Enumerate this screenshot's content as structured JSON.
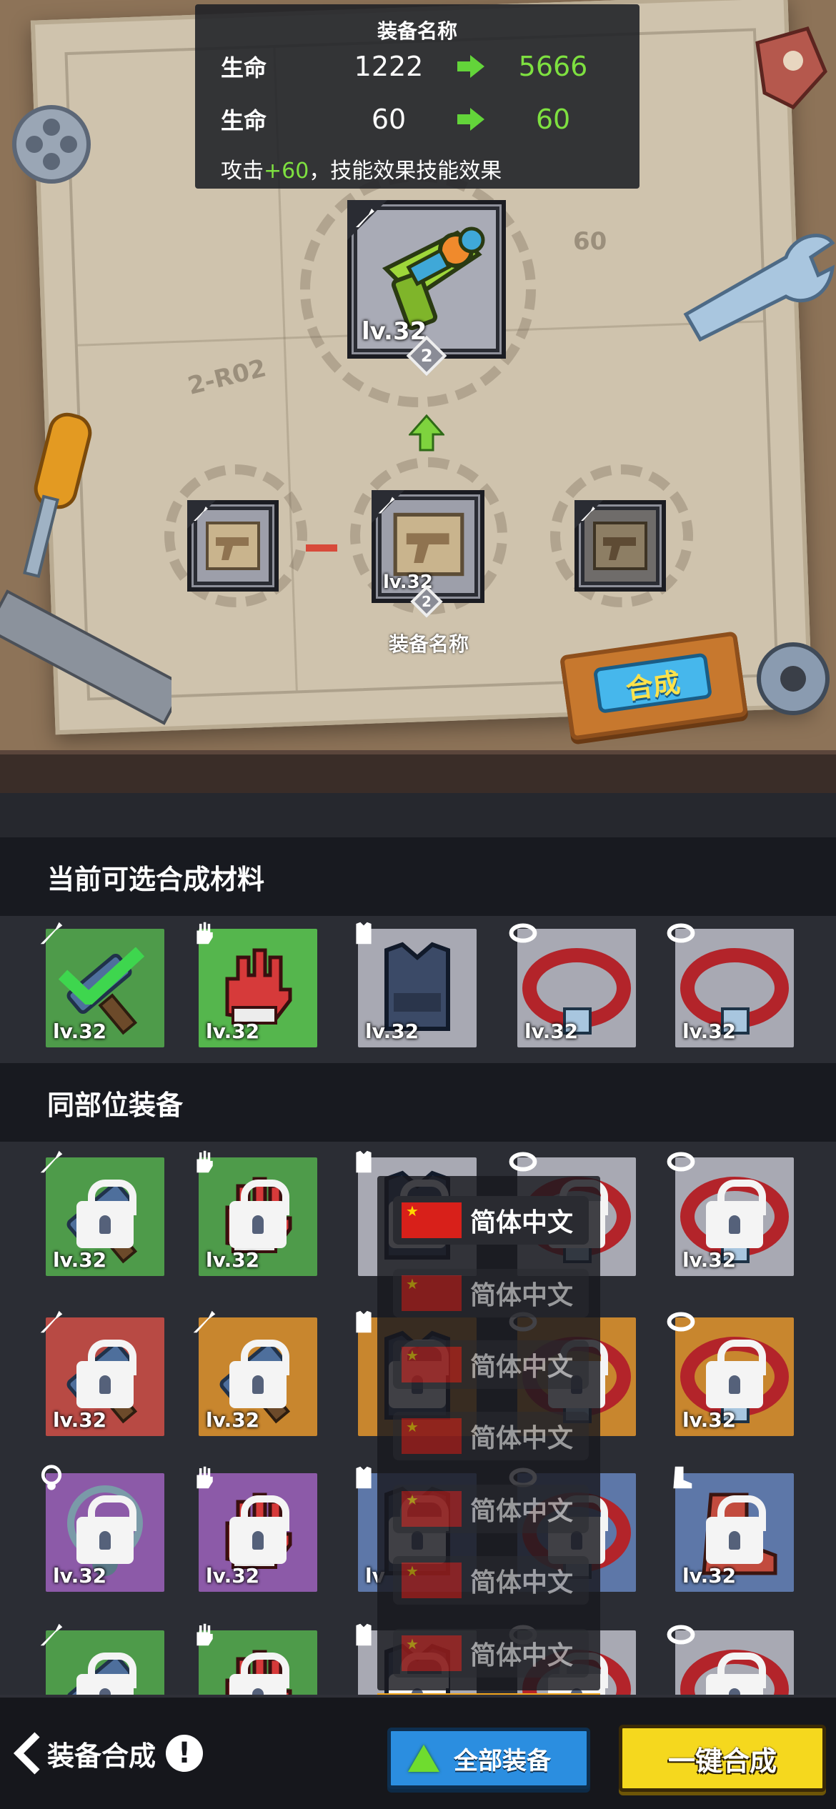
{
  "info_panel": {
    "title": "装备名称",
    "stats": [
      {
        "label": "生命",
        "old": "1222",
        "new": "5666"
      },
      {
        "label": "生命",
        "old": "60",
        "new": "60"
      }
    ],
    "desc_prefix": "攻击",
    "desc_bonus": "+60",
    "desc_suffix": "，技能效果技能效果"
  },
  "result_item": {
    "level": "lv.32",
    "stars": "2"
  },
  "materials_slots": [
    {
      "level": ""
    },
    {
      "level": "lv.32",
      "stars": "2",
      "name": "装备名称"
    },
    {
      "level": ""
    }
  ],
  "combine_button": "合成",
  "board_marks": [
    "2-R02",
    "60"
  ],
  "section_materials": {
    "title": "当前可选合成材料",
    "items": [
      {
        "level": "lv.32",
        "color": "#4e9b4a",
        "icon": "weapon-icon",
        "selected": true
      },
      {
        "level": "lv.32",
        "color": "#55b64d",
        "icon": "glove-icon"
      },
      {
        "level": "lv.32",
        "color": "#a8a9b3",
        "icon": "vest-icon"
      },
      {
        "level": "lv.32",
        "color": "#a8a9b3",
        "icon": "belt-icon"
      },
      {
        "level": "lv.32",
        "color": "#a8a9b3",
        "icon": "belt-icon"
      }
    ]
  },
  "section_same_slot": {
    "title": "同部位装备",
    "rows": [
      [
        {
          "level": "lv.32",
          "color": "#4e9b4a",
          "icon": "weapon-icon"
        },
        {
          "level": "lv.32",
          "color": "#4e9b4a",
          "icon": "glove-icon"
        },
        {
          "level": "",
          "color": "#a8a9b3",
          "icon": "vest-icon"
        },
        {
          "level": "",
          "color": "#a8a9b3",
          "icon": "belt-icon"
        },
        {
          "level": "lv.32",
          "color": "#a8a9b3",
          "icon": "belt-icon"
        }
      ],
      [
        {
          "level": "lv.32",
          "color": "#b84a44",
          "icon": "weapon-icon"
        },
        {
          "level": "lv.32",
          "color": "#c8862e",
          "icon": "weapon-icon"
        },
        {
          "level": "",
          "color": "#c8862e",
          "icon": "vest-icon"
        },
        {
          "level": "",
          "color": "#c8862e",
          "icon": "belt-icon"
        },
        {
          "level": "lv.32",
          "color": "#c8862e",
          "icon": "belt-icon"
        }
      ],
      [
        {
          "level": "lv.32",
          "color": "#8c5aa8",
          "icon": "necklace-icon"
        },
        {
          "level": "lv.32",
          "color": "#8c5aa8",
          "icon": "glove-icon"
        },
        {
          "level": "lv",
          "color": "#5d77a8",
          "icon": "vest-icon"
        },
        {
          "level": "",
          "color": "#5d77a8",
          "icon": "belt-icon"
        },
        {
          "level": "lv.32",
          "color": "#5d77a8",
          "icon": "boot-icon"
        }
      ],
      [
        {
          "level": "",
          "color": "#4e9b4a",
          "icon": "weapon-icon"
        },
        {
          "level": "",
          "color": "#4e9b4a",
          "icon": "glove-icon"
        },
        {
          "level": "",
          "color": "#a8a9b3",
          "icon": "vest-icon"
        },
        {
          "level": "",
          "color": "#a8a9b3",
          "icon": "belt-icon"
        },
        {
          "level": "",
          "color": "#a8a9b3",
          "icon": "belt-icon"
        }
      ]
    ]
  },
  "language_dropdown": {
    "options": [
      "简体中文",
      "简体中文",
      "简体中文",
      "简体中文",
      "简体中文",
      "简体中文",
      "简体中文"
    ],
    "selected_index": 0
  },
  "bottom_bar": {
    "title": "装备合成",
    "filter_button": "全部装备",
    "one_key_button": "一键合成"
  }
}
